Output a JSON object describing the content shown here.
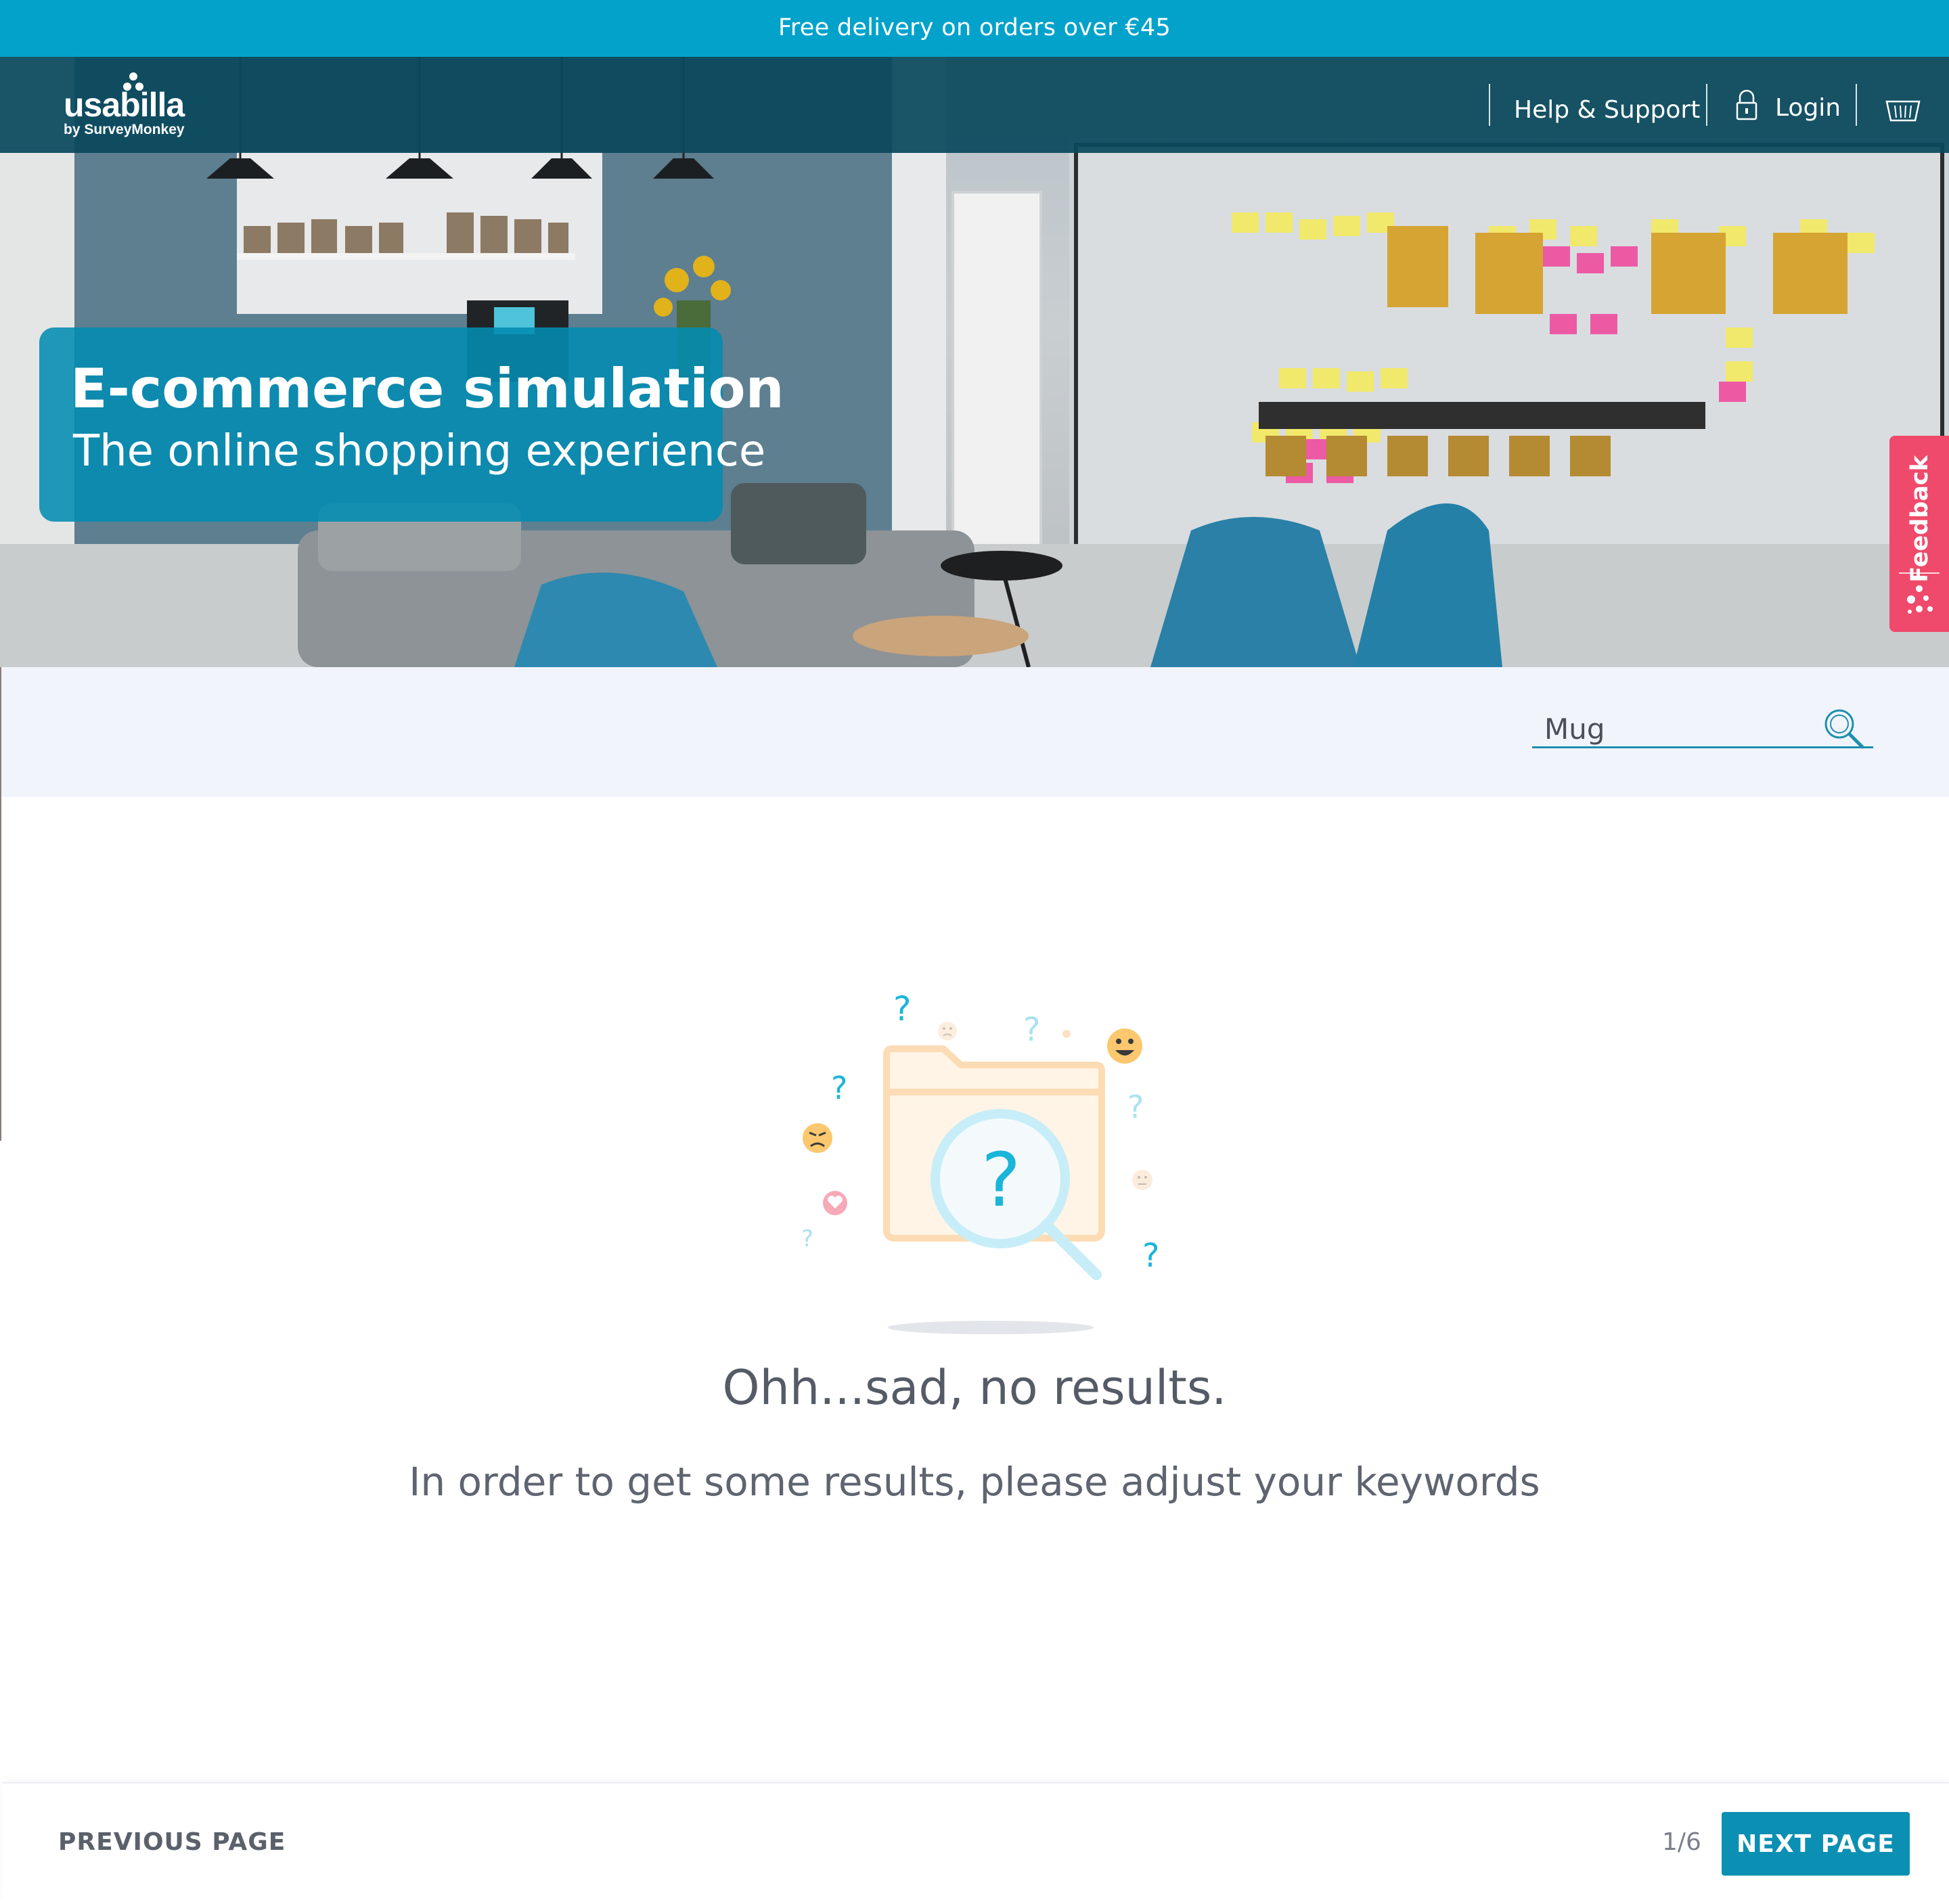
{
  "promo": {
    "text": "Free delivery on orders over €45"
  },
  "header": {
    "logo_text": "usabilla",
    "logo_sub": "by SurveyMonkey",
    "help_label": "Help & Support",
    "login_label": "Login"
  },
  "hero": {
    "title": "E-commerce simulation",
    "subtitle": "The online shopping experience"
  },
  "feedback_tab": {
    "label": "Feedback"
  },
  "search": {
    "value": "Mug",
    "placeholder": ""
  },
  "empty_state": {
    "title": "Ohh...sad, no results.",
    "subtitle": "In order to get some results, please adjust your keywords"
  },
  "pager": {
    "prev_label": "PREVIOUS PAGE",
    "page_indicator": "1/6",
    "next_label": "NEXT PAGE"
  },
  "colors": {
    "accent": "#03a2cb",
    "header_bg": "#0a485c",
    "feedback": "#ef4a6b",
    "button": "#0b8fb3"
  },
  "icons": [
    "lock-icon",
    "basket-icon",
    "search-icon",
    "usabilla-dots-icon"
  ]
}
